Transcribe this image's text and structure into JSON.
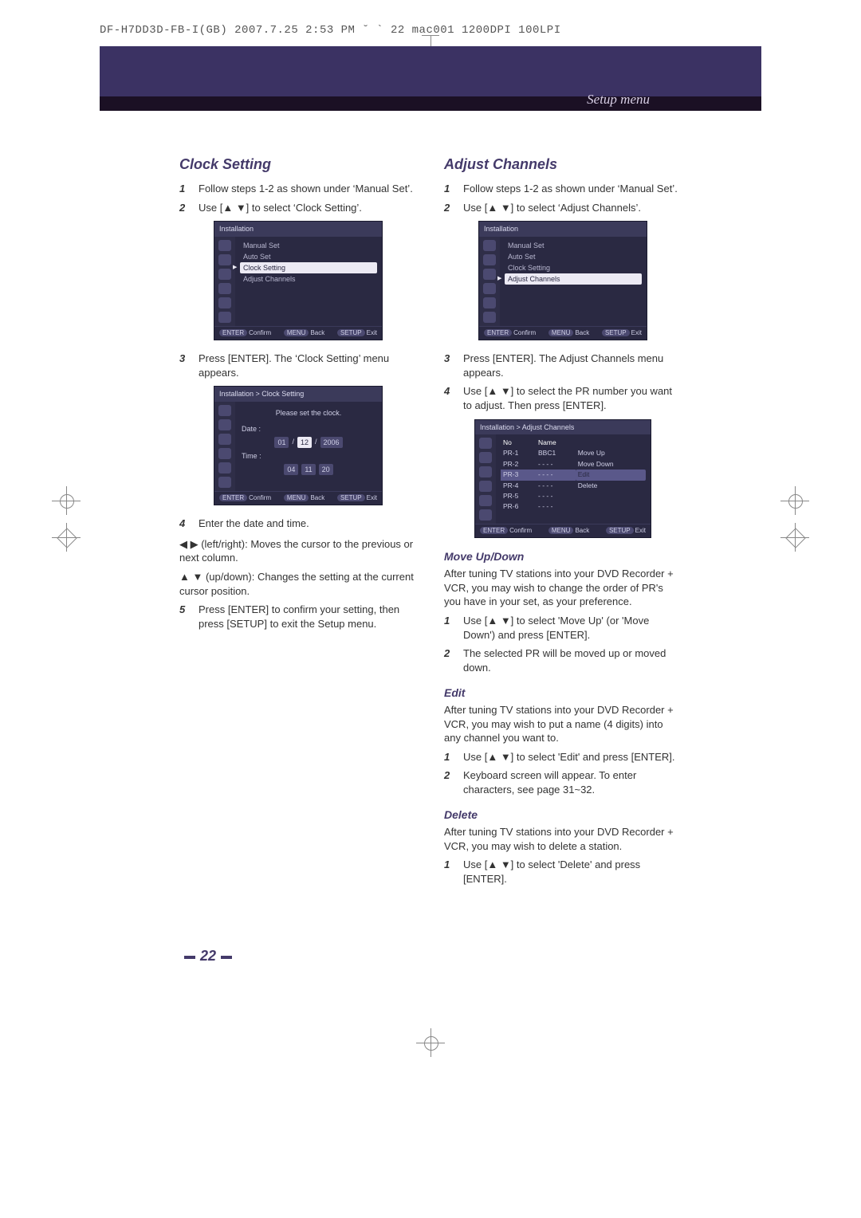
{
  "header_line": "DF-H7DD3D-FB-I(GB)  2007.7.25 2:53 PM  ˘ ` 22   mac001  1200DPI 100LPI",
  "breadcrumb": "Setup menu",
  "page_number": "22",
  "arrows": {
    "up": "▲",
    "down": "▼",
    "left": "◀",
    "right": "▶"
  },
  "left": {
    "title": "Clock Setting",
    "steps1": [
      "Follow steps 1-2 as shown under ‘Manual Set’.",
      "Use [▲ ▼] to select ‘Clock Setting’."
    ],
    "step3": "Press [ENTER]. The ‘Clock Setting’ menu appears.",
    "step4": "Enter the date and time.",
    "step4_a": "◀ ▶ (left/right): Moves the cursor to the previous or next column.",
    "step4_b": "▲ ▼ (up/down): Changes the setting at the current cursor position.",
    "step5": "Press [ENTER] to confirm your setting, then press [SETUP] to exit the Setup menu."
  },
  "right": {
    "title": "Adjust Channels",
    "steps1": [
      "Follow steps 1-2 as shown under ‘Manual Set’.",
      "Use [▲ ▼] to select ‘Adjust Channels’."
    ],
    "step3": "Press [ENTER]. The Adjust Channels menu appears.",
    "step4": "Use [▲ ▼] to select the PR number you want to adjust. Then press [ENTER].",
    "move_title": "Move Up/Down",
    "move_body": "After tuning TV stations into your DVD Recorder + VCR, you may wish to change the order of PR's you have in your set, as your preference.",
    "move_s1": "Use [▲ ▼] to select 'Move Up' (or 'Move Down') and press [ENTER].",
    "move_s2": "The selected PR will be moved up or moved down.",
    "edit_title": "Edit",
    "edit_body": "After tuning TV stations into your DVD Recorder + VCR, you may wish to put a name (4 digits) into any channel you want to.",
    "edit_s1": "Use [▲ ▼] to select 'Edit' and press [ENTER].",
    "edit_s2": "Keyboard screen will appear. To enter characters, see page 31~32.",
    "del_title": "Delete",
    "del_body": "After tuning TV stations into your DVD Recorder + VCR, you may wish to delete a station.",
    "del_s1": "Use [▲ ▼] to select 'Delete' and press [ENTER]."
  },
  "osd_common": {
    "footer_confirm": "Confirm",
    "footer_back": "Back",
    "footer_exit": "Exit",
    "btn_enter": "ENTER",
    "btn_menu": "MENU",
    "btn_setup": "SETUP"
  },
  "osd1": {
    "title": "Installation",
    "items": [
      "Manual Set",
      "Auto Set",
      "Clock Setting",
      "Adjust Channels"
    ],
    "selected_index": 2
  },
  "osd2": {
    "title": "Installation  > Clock Setting",
    "prompt": "Please set the clock.",
    "date_label": "Date :",
    "time_label": "Time :",
    "date": [
      "01",
      "12",
      "2006"
    ],
    "time": [
      "04",
      "11",
      "20"
    ],
    "date_sel_index": 1
  },
  "osd3": {
    "title": "Installation",
    "items": [
      "Manual Set",
      "Auto Set",
      "Clock Setting",
      "Adjust Channels"
    ],
    "selected_index": 3
  },
  "osd4": {
    "title": "Installation  > Adjust Channels",
    "cols": [
      "No",
      "Name"
    ],
    "rows": [
      {
        "no": "PR-1",
        "name": "BBC1"
      },
      {
        "no": "PR-2",
        "name": "- - - -"
      },
      {
        "no": "PR-3",
        "name": "- - - -"
      },
      {
        "no": "PR-4",
        "name": "- - - -"
      },
      {
        "no": "PR-5",
        "name": "- - - -"
      },
      {
        "no": "PR-6",
        "name": "- - - -"
      }
    ],
    "selected_row": 2,
    "actions": [
      "Move Up",
      "Move Down",
      "Edit",
      "Delete"
    ],
    "action_sel": 2
  }
}
